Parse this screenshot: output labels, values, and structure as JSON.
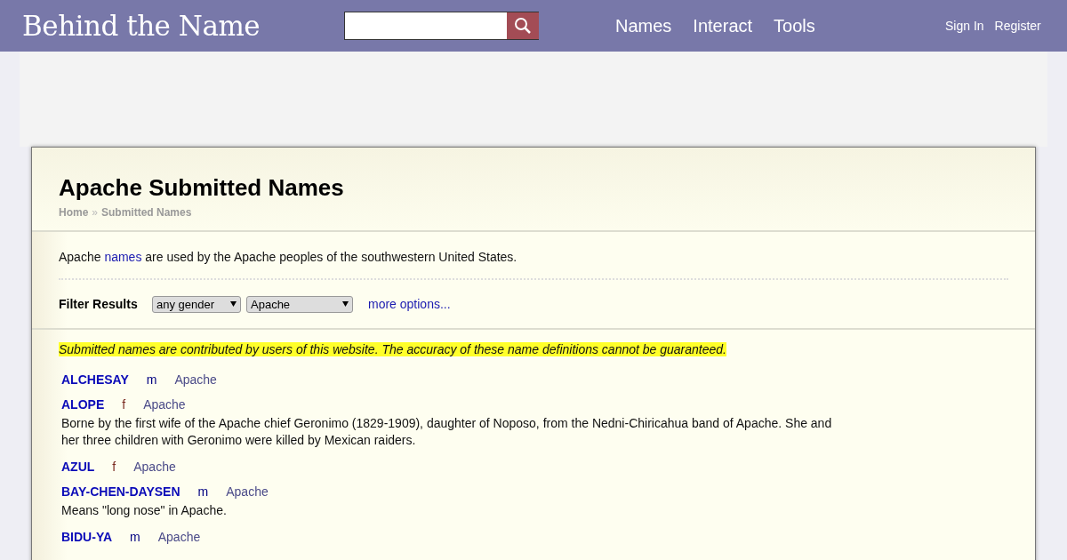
{
  "header": {
    "logo": "Behind the Name",
    "nav": [
      "Names",
      "Interact",
      "Tools"
    ],
    "account": [
      "Sign In",
      "Register"
    ]
  },
  "page": {
    "title": "Apache Submitted Names",
    "breadcrumb": [
      "Home",
      "Submitted Names"
    ],
    "breadcrumb_separator": "»",
    "intro": {
      "before": "Apache ",
      "link": "names",
      "after": " are used by the Apache peoples of the southwestern United States."
    },
    "filter": {
      "label": "Filter Results",
      "gender": "any gender",
      "language": "Apache",
      "more": "more options..."
    },
    "notice": "Submitted names are contributed by users of this website. The accuracy of these name definitions cannot be guaranteed.",
    "names": [
      {
        "name": "ALCHESAY",
        "gender": "m",
        "kind": "masculine",
        "usage": "Apache"
      },
      {
        "name": "ALOPE",
        "gender": "f",
        "kind": "feminine",
        "usage": "Apache",
        "meaning": "Borne by the first wife of the Apache chief Geronimo (1829-1909), daughter of Noposo, from the Nedni-Chiricahua band of Apache. She and her three children with Geronimo were killed by Mexican raiders."
      },
      {
        "name": "AZUL",
        "gender": "f",
        "kind": "feminine",
        "usage": "Apache"
      },
      {
        "name": "BAY-CHEN-DAYSEN",
        "gender": "m",
        "kind": "masculine",
        "usage": "Apache",
        "meaning": "Means \"long nose\" in Apache."
      },
      {
        "name": "BIDU-YA",
        "gender": "m",
        "kind": "masculine",
        "usage": "Apache"
      }
    ]
  }
}
